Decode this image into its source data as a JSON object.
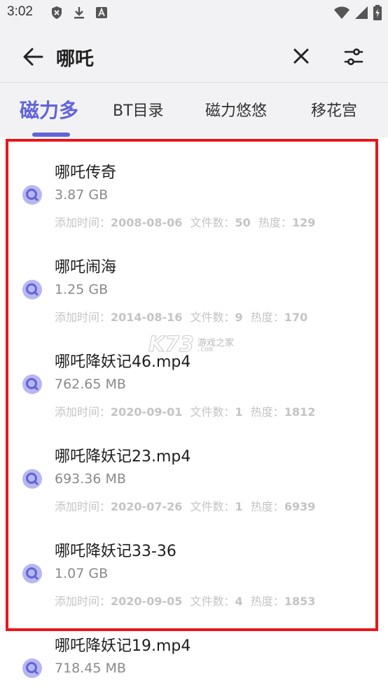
{
  "status_bar": {
    "time": "3:02"
  },
  "header": {
    "search_value": "哪吒"
  },
  "tabs": [
    {
      "label": "磁力多",
      "active": true
    },
    {
      "label": "BT目录",
      "active": false
    },
    {
      "label": "磁力悠悠",
      "active": false
    },
    {
      "label": "移花宫",
      "active": false
    }
  ],
  "meta_labels": {
    "added": "添加时间：",
    "files": "文件数：",
    "heat": "热度："
  },
  "results": [
    {
      "title": "哪吒传奇",
      "size": "3.87 GB",
      "added": "2008-08-06",
      "files": "50",
      "heat": "129"
    },
    {
      "title": "哪吒闹海",
      "size": "1.25 GB",
      "added": "2014-08-16",
      "files": "9",
      "heat": "170"
    },
    {
      "title": "哪吒降妖记46.mp4",
      "size": "762.65 MB",
      "added": "2020-09-01",
      "files": "1",
      "heat": "1812"
    },
    {
      "title": "哪吒降妖记23.mp4",
      "size": "693.36 MB",
      "added": "2020-07-26",
      "files": "1",
      "heat": "6939"
    },
    {
      "title": "哪吒降妖记33-36",
      "size": "1.07 GB",
      "added": "2020-09-05",
      "files": "4",
      "heat": "1853"
    },
    {
      "title": "哪吒降妖记19.mp4",
      "size": "718.45 MB",
      "added": "",
      "files": "",
      "heat": ""
    }
  ],
  "watermark": {
    "logo": "K73",
    "sub": "游戏之家",
    "url": ".com"
  },
  "colors": {
    "accent": "#6164d9",
    "highlight_border": "#e8161c",
    "header_bg": "#f2f2f4"
  }
}
